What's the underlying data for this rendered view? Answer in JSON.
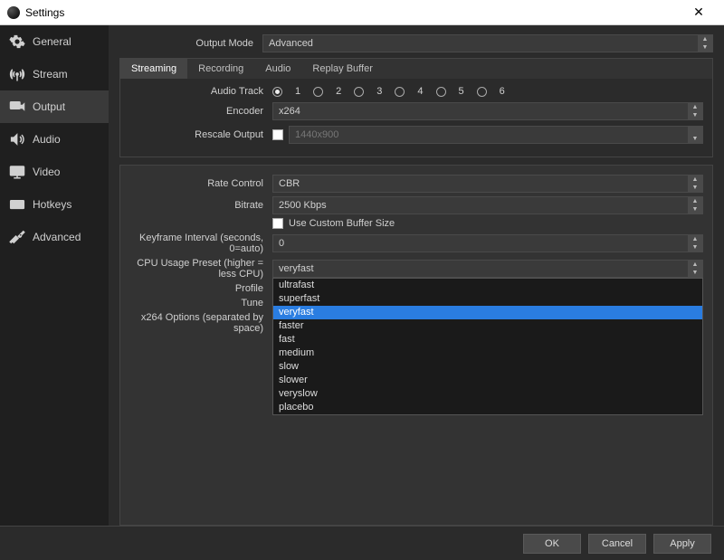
{
  "window": {
    "title": "Settings",
    "close": "✕"
  },
  "sidebar": {
    "items": [
      {
        "label": "General"
      },
      {
        "label": "Stream"
      },
      {
        "label": "Output"
      },
      {
        "label": "Audio"
      },
      {
        "label": "Video"
      },
      {
        "label": "Hotkeys"
      },
      {
        "label": "Advanced"
      }
    ],
    "active_index": 2
  },
  "output_mode": {
    "label": "Output Mode",
    "value": "Advanced"
  },
  "tabs": {
    "items": [
      {
        "label": "Streaming"
      },
      {
        "label": "Recording"
      },
      {
        "label": "Audio"
      },
      {
        "label": "Replay Buffer"
      }
    ],
    "active_index": 0
  },
  "streaming": {
    "audio_track": {
      "label": "Audio Track",
      "options": [
        "1",
        "2",
        "3",
        "4",
        "5",
        "6"
      ],
      "selected": "1"
    },
    "encoder": {
      "label": "Encoder",
      "value": "x264"
    },
    "rescale": {
      "label": "Rescale Output",
      "checked": false,
      "value": "1440x900"
    },
    "rate_control": {
      "label": "Rate Control",
      "value": "CBR"
    },
    "bitrate": {
      "label": "Bitrate",
      "value": "2500 Kbps"
    },
    "custom_buffer": {
      "label": "Use Custom Buffer Size",
      "checked": false
    },
    "keyframe": {
      "label": "Keyframe Interval (seconds, 0=auto)",
      "value": "0"
    },
    "cpu_preset": {
      "label": "CPU Usage Preset (higher = less CPU)",
      "value": "veryfast",
      "options": [
        "ultrafast",
        "superfast",
        "veryfast",
        "faster",
        "fast",
        "medium",
        "slow",
        "slower",
        "veryslow",
        "placebo"
      ],
      "highlighted": "veryfast"
    },
    "profile": {
      "label": "Profile"
    },
    "tune": {
      "label": "Tune"
    },
    "x264_opts": {
      "label": "x264 Options (separated by space)"
    }
  },
  "footer": {
    "ok": "OK",
    "cancel": "Cancel",
    "apply": "Apply"
  }
}
